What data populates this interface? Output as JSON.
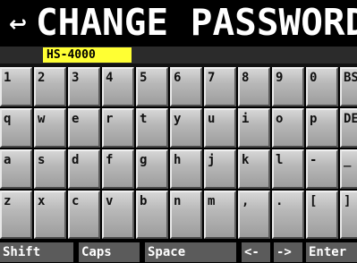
{
  "header": {
    "back_symbol": "↩",
    "title": "CHANGE PASSWORD"
  },
  "input": {
    "value": "HS-4000"
  },
  "keyboard": {
    "rows": [
      [
        "1",
        "2",
        "3",
        "4",
        "5",
        "6",
        "7",
        "8",
        "9",
        "0",
        "BS"
      ],
      [
        "q",
        "w",
        "e",
        "r",
        "t",
        "y",
        "u",
        "i",
        "o",
        "p",
        "DEL"
      ],
      [
        "a",
        "s",
        "d",
        "f",
        "g",
        "h",
        "j",
        "k",
        "l",
        "-",
        "_"
      ],
      [
        "z",
        "x",
        "c",
        "v",
        "b",
        "n",
        "m",
        ",",
        ".",
        "[",
        "]"
      ]
    ],
    "function_keys": {
      "shift": "Shift",
      "caps": "Caps",
      "space": "Space",
      "left": "<-",
      "right": "->",
      "enter": "Enter"
    }
  },
  "colors": {
    "input_highlight": "#ffff33",
    "key_face": "#bdbdbd",
    "function_bar": "#5b5b5b",
    "background": "#000000"
  }
}
